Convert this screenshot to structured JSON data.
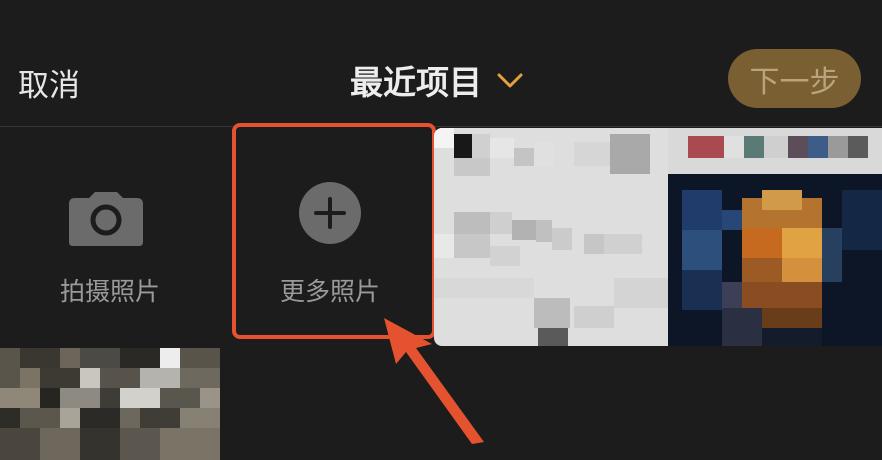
{
  "header": {
    "cancel_label": "取消",
    "title": "最近项目",
    "next_label": "下一步"
  },
  "tiles": {
    "camera_label": "拍摄照片",
    "more_label": "更多照片"
  },
  "colors": {
    "accent": "#e5a13a",
    "next_button_bg": "#7a5f33",
    "highlight": "#e5522f"
  },
  "icons": {
    "camera": "camera-icon",
    "plus": "plus-circle-icon",
    "chevron": "chevron-down-icon",
    "arrow": "pointer-arrow-icon"
  }
}
